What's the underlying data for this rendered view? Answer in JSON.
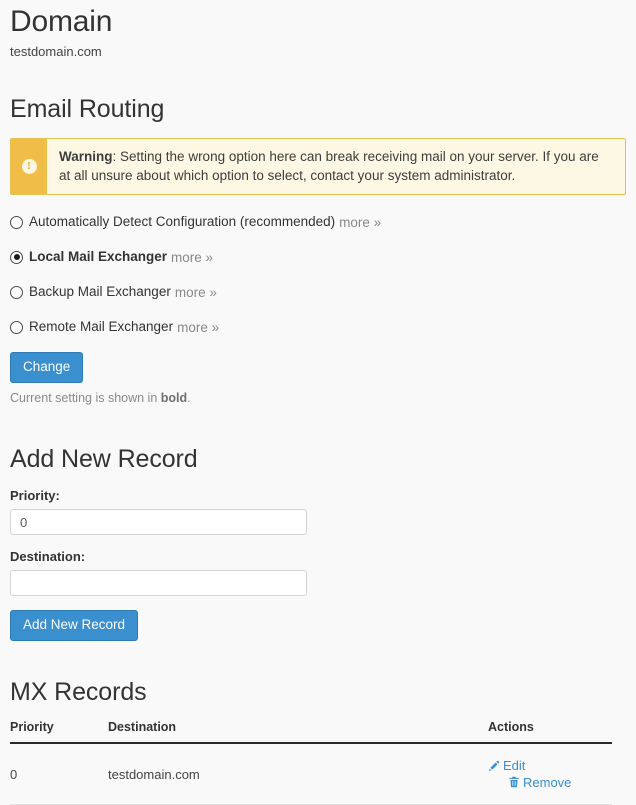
{
  "header": {
    "title": "Domain",
    "domain_name": "testdomain.com"
  },
  "email_routing": {
    "title": "Email Routing",
    "warning": {
      "icon": "exclamation-circle-icon",
      "label": "Warning",
      "separator": ":",
      "text": " Setting the wrong option here can break receiving mail on your server. If you are at all unsure about which option to select, contact your system administrator.",
      "accent_color": "#efbd48",
      "background_color": "#fcf8e3"
    },
    "options": [
      {
        "label": "Automatically Detect Configuration (recommended)",
        "more_label": "more »",
        "selected": false,
        "bold": false
      },
      {
        "label": "Local Mail Exchanger",
        "more_label": "more »",
        "selected": true,
        "bold": true
      },
      {
        "label": "Backup Mail Exchanger",
        "more_label": "more »",
        "selected": false,
        "bold": false
      },
      {
        "label": "Remote Mail Exchanger",
        "more_label": "more »",
        "selected": false,
        "bold": false
      }
    ],
    "change_button": "Change",
    "note_prefix": "Current setting is shown in ",
    "note_bold": "bold",
    "note_suffix": "."
  },
  "add_new_record": {
    "title": "Add New Record",
    "priority_label": "Priority:",
    "priority_value": "0",
    "priority_placeholder": "",
    "destination_label": "Destination:",
    "destination_value": "",
    "destination_placeholder": "",
    "submit_button": "Add New Record"
  },
  "mx_records": {
    "title": "MX Records",
    "columns": [
      "Priority",
      "Destination",
      "Actions"
    ],
    "rows": [
      {
        "priority": "0",
        "destination": "testdomain.com",
        "edit_label": "Edit",
        "remove_label": "Remove"
      }
    ]
  },
  "theme": {
    "primary_button": "#3a8fce",
    "link_color": "#3a8fce",
    "page_background": "#f9f9f9"
  }
}
